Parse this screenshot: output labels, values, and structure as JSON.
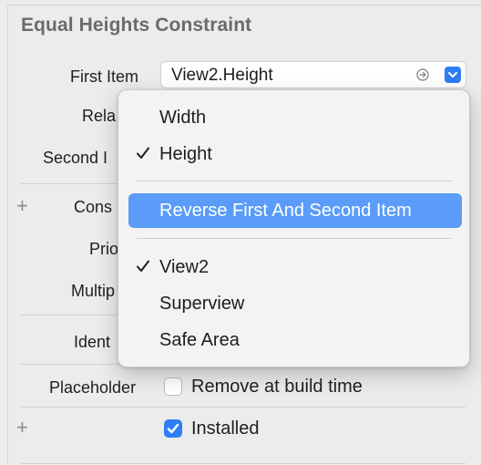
{
  "section": {
    "title": "Equal Heights Constraint"
  },
  "rows": {
    "first_item_label": "First Item",
    "relation_label": "Rela",
    "second_item_label": "Second I",
    "constant_label": "Cons",
    "priority_label": "Prio",
    "multiplier_label": "Multip",
    "identifier_label": "Ident",
    "placeholder_label": "Placeholder"
  },
  "first_item_field": {
    "value": "View2.Height"
  },
  "placeholder_checkbox": {
    "label": "Remove at build time",
    "checked": false
  },
  "installed_checkbox": {
    "label": "Installed",
    "checked": true
  },
  "menu": {
    "attributes": [
      {
        "label": "Width",
        "checked": false
      },
      {
        "label": "Height",
        "checked": true
      }
    ],
    "action": {
      "label": "Reverse First And Second Item",
      "highlighted": true
    },
    "items": [
      {
        "label": "View2",
        "checked": true
      },
      {
        "label": "Superview",
        "checked": false
      },
      {
        "label": "Safe Area",
        "checked": false
      }
    ]
  },
  "colors": {
    "accent": "#2f7ef5",
    "highlight": "#5a9cf8"
  }
}
